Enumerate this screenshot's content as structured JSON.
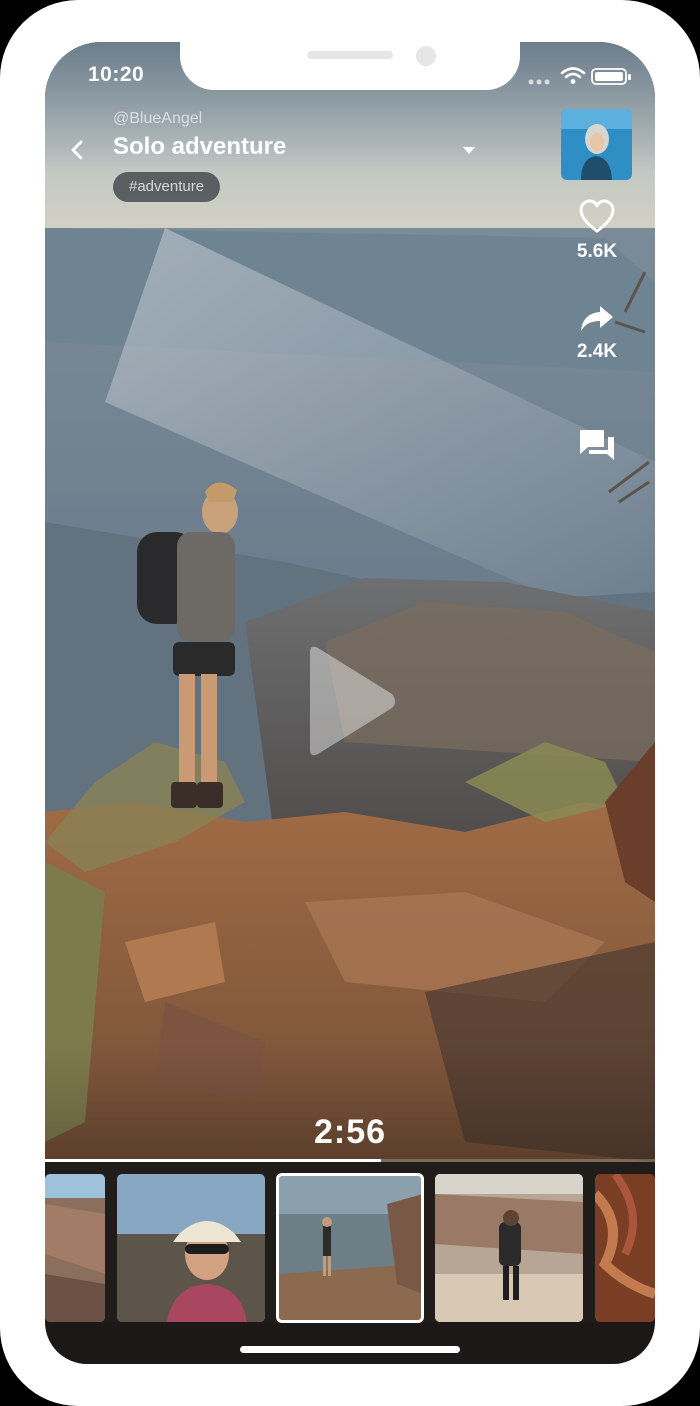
{
  "status_bar": {
    "time": "10:20",
    "icons": [
      "signal-icon",
      "wifi-icon",
      "battery-icon"
    ]
  },
  "header": {
    "username": "@BlueAngel",
    "title": "Solo adventure",
    "hashtag": "#adventure"
  },
  "actions": {
    "likes": "5.6K",
    "shares": "2.4K"
  },
  "player": {
    "time": "2:56",
    "progress": 0.55
  },
  "thumbnails": [
    {
      "name": "thumb-canyon-left",
      "active": false
    },
    {
      "name": "thumb-smiling-hiker",
      "active": false
    },
    {
      "name": "thumb-hiker-ledge",
      "active": true
    },
    {
      "name": "thumb-hiker-backpack",
      "active": false
    },
    {
      "name": "thumb-red-rock",
      "active": false
    }
  ],
  "colors": {
    "accent": "#ffffff",
    "sky": "#b9c4c8",
    "canyon": "#7b6a58",
    "rock": "#9a6a4a"
  }
}
